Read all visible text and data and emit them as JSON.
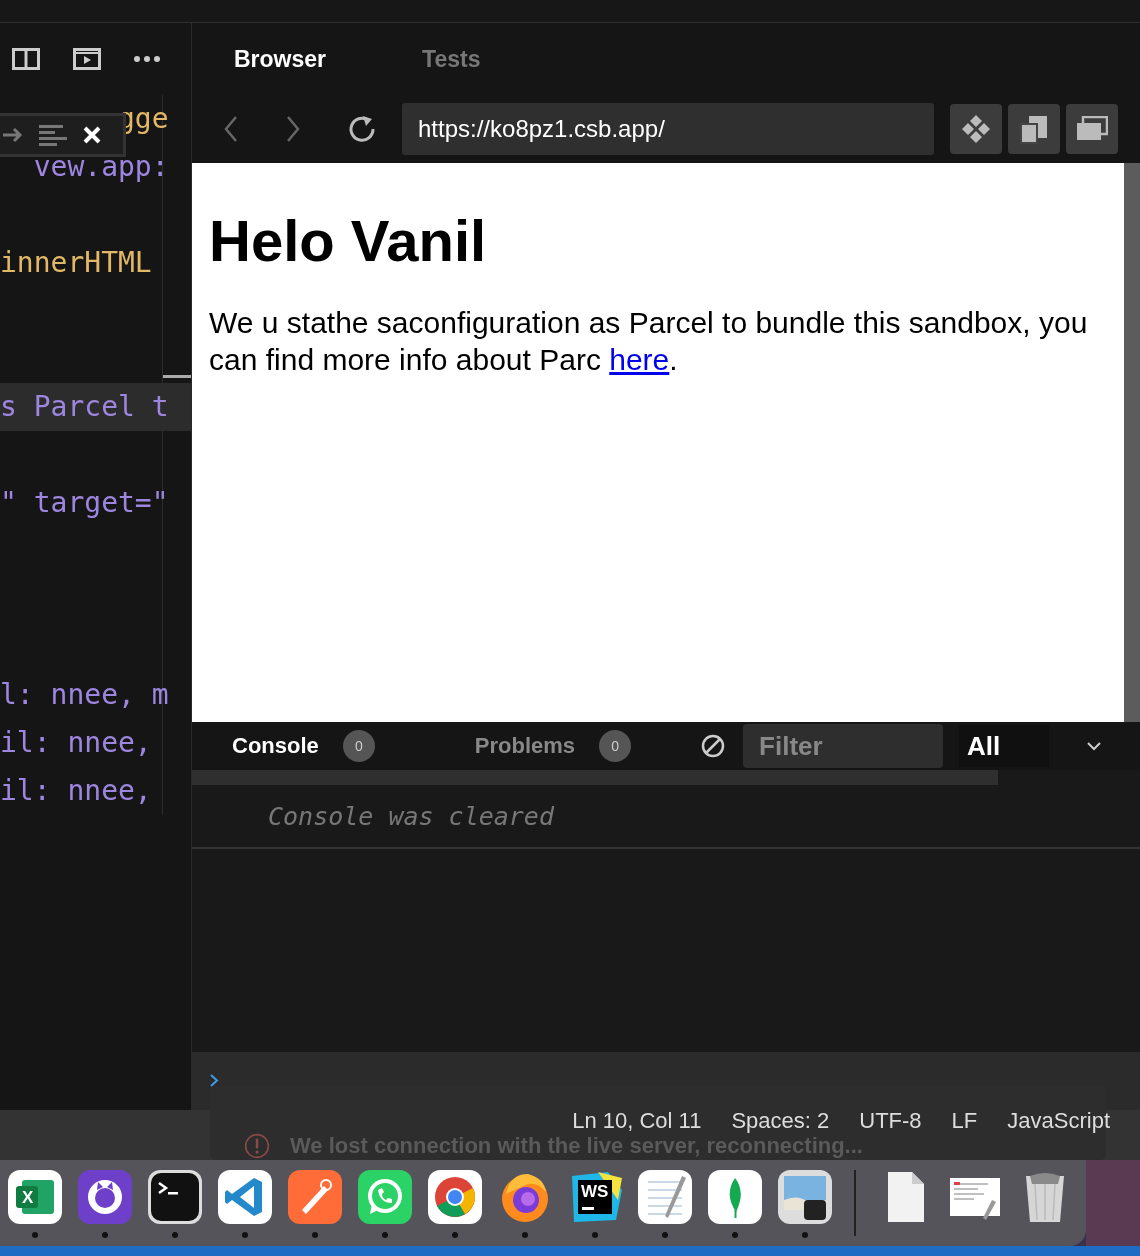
{
  "editor": {
    "code_lines": [
      {
        "kind": "code",
        "text": "       gge",
        "color": "#e2b866",
        "highlighted": false
      },
      {
        "kind": "code",
        "text": "  vew.app:",
        "color": "#9d86e0",
        "highlighted": false
      },
      {
        "kind": "blank"
      },
      {
        "kind": "code",
        "text": "innerHTML",
        "color": "#e2b866",
        "highlighted": false
      },
      {
        "kind": "blank"
      },
      {
        "kind": "blank"
      },
      {
        "kind": "code",
        "text": "s Parcel t",
        "color": "#9d86e0",
        "highlighted": true
      },
      {
        "kind": "blank"
      },
      {
        "kind": "code",
        "text": "\" target=\"",
        "color": "#9d86e0",
        "highlighted": false
      },
      {
        "kind": "blank"
      },
      {
        "kind": "blank"
      },
      {
        "kind": "blank"
      },
      {
        "kind": "code",
        "text": "l: nnee, m",
        "color": "#9d86e0",
        "highlighted": false
      },
      {
        "kind": "code",
        "text": "il: nnee,",
        "color": "#9d86e0",
        "highlighted": false
      },
      {
        "kind": "code",
        "text": "il: nnee,",
        "color": "#9d86e0",
        "highlighted": false
      }
    ]
  },
  "preview_tabs": [
    {
      "label": "Browser",
      "selected": true
    },
    {
      "label": "Tests",
      "selected": false
    }
  ],
  "browser": {
    "back_disabled": true,
    "forward_disabled": true,
    "url": "https://ko8pz1.csb.app/"
  },
  "page": {
    "heading": "Helo Vanil",
    "paragraph": "We u stathe saconfiguration as Parcel to bundle this sandbox, you can find more info about Parc ",
    "link": "here",
    "after_link": "."
  },
  "console_tabs": [
    {
      "label": "Console",
      "count": "0",
      "selected": true
    },
    {
      "label": "Problems",
      "count": "0",
      "selected": false
    }
  ],
  "console": {
    "filter_placeholder": "Filter",
    "level": "All",
    "messages": [
      "Console was cleared"
    ]
  },
  "toast": {
    "text": "We lost connection with the live server, reconnecting..."
  },
  "status_bar": [
    "Ln 10, Col 11",
    "Spaces: 2",
    "UTF-8",
    "LF",
    "JavaScript"
  ],
  "dock": [
    {
      "kind": "spreadsheet",
      "label": "X",
      "running": true
    },
    {
      "kind": "cat",
      "running": true
    },
    {
      "kind": "terminal",
      "running": true
    },
    {
      "kind": "code",
      "running": true
    },
    {
      "kind": "pen",
      "running": true
    },
    {
      "kind": "chat",
      "running": true
    },
    {
      "kind": "chrome",
      "running": true
    },
    {
      "kind": "fox",
      "running": true
    },
    {
      "kind": "ide",
      "label": "WS",
      "running": true
    },
    {
      "kind": "notes",
      "running": true
    },
    {
      "kind": "leaf",
      "running": true
    },
    {
      "kind": "preview",
      "running": true
    },
    {
      "kind": "separator"
    },
    {
      "kind": "file",
      "running": false
    },
    {
      "kind": "document",
      "running": false
    },
    {
      "kind": "trash",
      "running": false
    }
  ]
}
